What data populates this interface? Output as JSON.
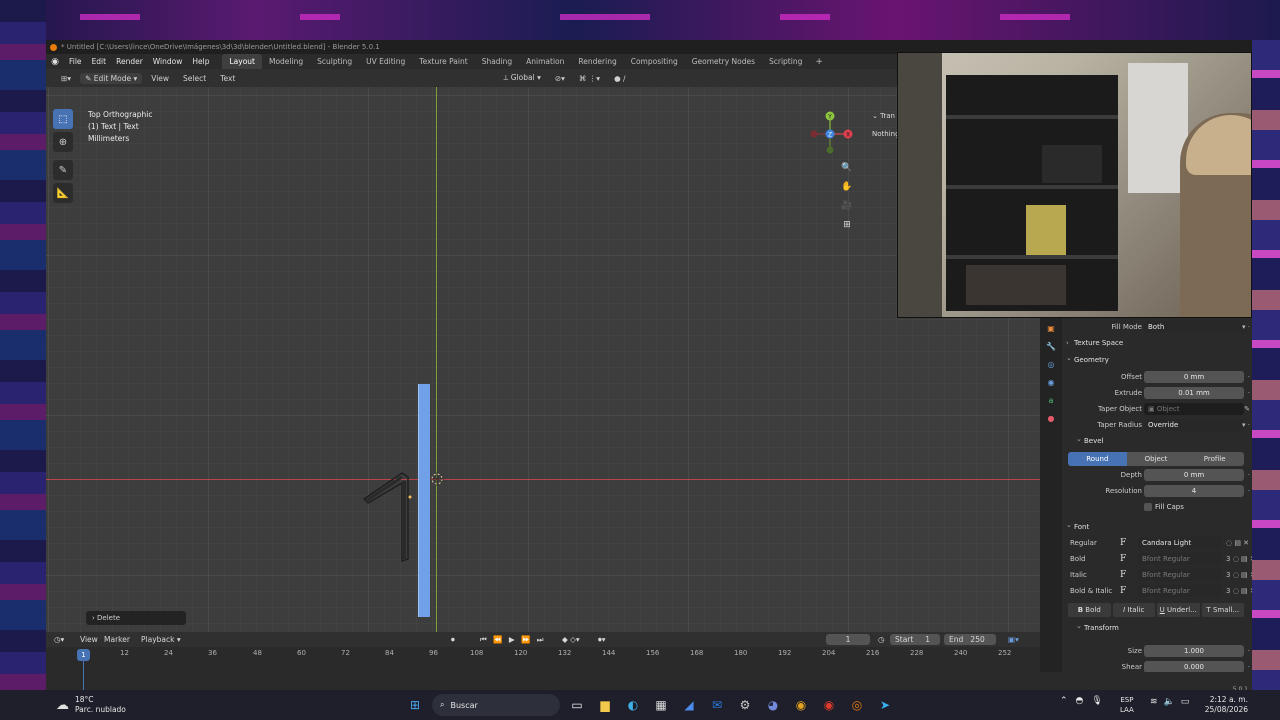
{
  "window": {
    "title": "* Untitled [C:\\Users\\lince\\OneDrive\\Imágenes\\3d\\3d\\blender\\Untitled.blend] - Blender 5.0.1"
  },
  "topbar": {
    "menus": [
      "File",
      "Edit",
      "Render",
      "Window",
      "Help"
    ],
    "workspaces": [
      "Layout",
      "Modeling",
      "Sculpting",
      "UV Editing",
      "Texture Paint",
      "Shading",
      "Animation",
      "Rendering",
      "Compositing",
      "Geometry Nodes",
      "Scripting"
    ],
    "active_workspace": "Layout",
    "add_label": "+"
  },
  "viewport_header": {
    "mode": "Edit Mode",
    "menus": [
      "View",
      "Select",
      "Text"
    ],
    "orientation": "Global"
  },
  "viewport": {
    "view_name": "Top Orthographic",
    "object_info": "(1) Text | Text",
    "units": "Millimeters",
    "npanel_tab": "Tran",
    "npanel_text": "Nothing",
    "gizmo_axes": {
      "y": "Y",
      "x": "X",
      "z": "Z"
    },
    "last_operator": "Delete"
  },
  "properties": {
    "fill_mode": {
      "label": "Fill Mode",
      "value": "Both"
    },
    "texture_space": "Texture Space",
    "geometry": "Geometry",
    "offset": {
      "label": "Offset",
      "value": "0 mm"
    },
    "extrude": {
      "label": "Extrude",
      "value": "0.01 mm"
    },
    "taper_object": {
      "label": "Taper Object",
      "placeholder": "Object"
    },
    "taper_radius": {
      "label": "Taper Radius",
      "value": "Override"
    },
    "bevel": "Bevel",
    "bevel_modes": [
      "Round",
      "Object",
      "Profile"
    ],
    "bevel_active": "Round",
    "depth": {
      "label": "Depth",
      "value": "0 mm"
    },
    "resolution": {
      "label": "Resolution",
      "value": "4"
    },
    "fill_caps": "Fill Caps",
    "font": "Font",
    "fonts": [
      {
        "label": "Regular",
        "value": "Candara Light",
        "users": ""
      },
      {
        "label": "Bold",
        "value": "Bfont Regular",
        "users": "3"
      },
      {
        "label": "Italic",
        "value": "Bfont Regular",
        "users": "3"
      },
      {
        "label": "Bold & Italic",
        "value": "Bfont Regular",
        "users": "3"
      }
    ],
    "styles": [
      "Bold",
      "Italic",
      "Underl...",
      "Small..."
    ],
    "transform": "Transform",
    "size": {
      "label": "Size",
      "value": "1.000"
    },
    "shear": {
      "label": "Shear",
      "value": "0.000"
    }
  },
  "timeline": {
    "menus": [
      "View",
      "Marker",
      "Playback"
    ],
    "current_frame": "1",
    "start_label": "Start",
    "start_value": "1",
    "end_label": "End",
    "end_value": "250",
    "ruler": [
      "12",
      "24",
      "36",
      "48",
      "60",
      "72",
      "84",
      "96",
      "108",
      "120",
      "132",
      "144",
      "156",
      "168",
      "180",
      "192",
      "204",
      "216",
      "228",
      "240",
      "252"
    ],
    "playhead": "1"
  },
  "statusbar": {
    "version": "5.0.1"
  },
  "taskbar": {
    "weather_temp": "18°C",
    "weather_desc": "Parc. nublado",
    "search_label": "Buscar",
    "lang_top": "ESP",
    "lang_bottom": "LAA",
    "time": "2:12 a. m.",
    "date": "25/08/2026"
  }
}
